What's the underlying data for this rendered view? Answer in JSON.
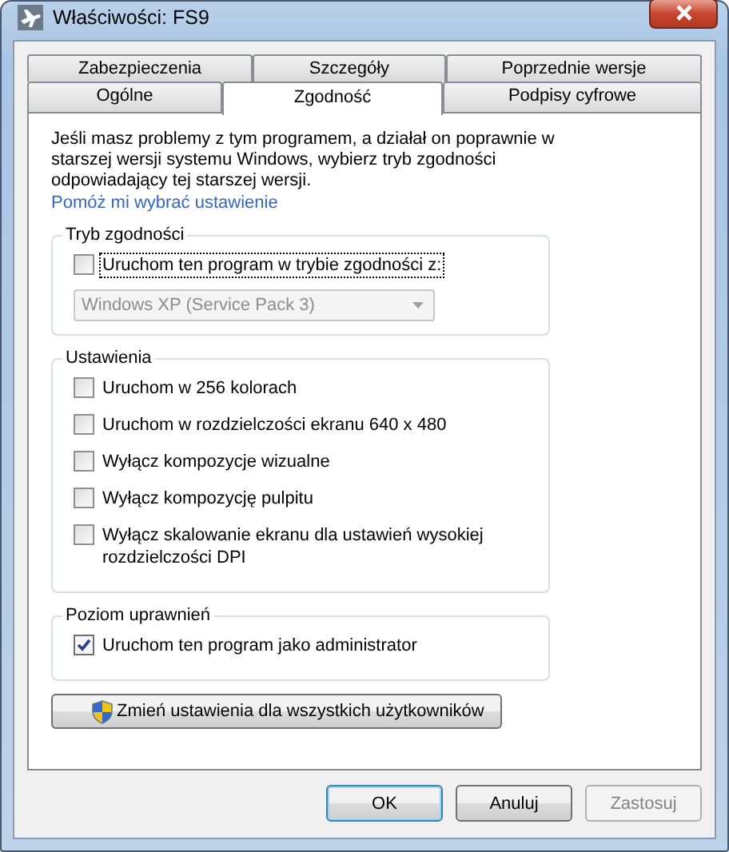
{
  "window": {
    "title": "Właściwości: FS9"
  },
  "tab_rows": [
    [
      {
        "label": "Zabezpieczenia",
        "selected": false
      },
      {
        "label": "Szczegóły",
        "selected": false
      },
      {
        "label": "Poprzednie wersje",
        "selected": false
      }
    ],
    [
      {
        "label": "Ogólne",
        "selected": false
      },
      {
        "label": "Zgodność",
        "selected": true
      },
      {
        "label": "Podpisy cyfrowe",
        "selected": false
      }
    ]
  ],
  "intro": "Jeśli masz problemy z tym programem, a działał on poprawnie w starszej wersji systemu Windows, wybierz tryb zgodności odpowiadający tej starszej wersji.",
  "help_link": "Pomóż mi wybrać ustawienie",
  "groups": [
    {
      "title": "Tryb zgodności",
      "items": [
        {
          "kind": "checkbox",
          "label": "Uruchom ten program w trybie zgodności z:",
          "checked": false,
          "focused": true
        },
        {
          "kind": "dropdown",
          "value": "Windows XP (Service Pack 3)",
          "disabled": true
        }
      ]
    },
    {
      "title": "Ustawienia",
      "items": [
        {
          "kind": "checkbox",
          "label": "Uruchom w 256 kolorach",
          "checked": false,
          "focused": false
        },
        {
          "kind": "checkbox",
          "label": "Uruchom w rozdzielczości ekranu 640 x 480",
          "checked": false,
          "focused": false
        },
        {
          "kind": "checkbox",
          "label": "Wyłącz kompozycje wizualne",
          "checked": false,
          "focused": false
        },
        {
          "kind": "checkbox",
          "label": "Wyłącz kompozycję pulpitu",
          "checked": false,
          "focused": false
        },
        {
          "kind": "checkbox",
          "label": "Wyłącz skalowanie ekranu dla ustawień wysokiej rozdzielczości DPI",
          "checked": false,
          "focused": false
        }
      ]
    },
    {
      "title": "Poziom uprawnień",
      "items": [
        {
          "kind": "checkbox",
          "label": "Uruchom ten program jako administrator",
          "checked": true,
          "focused": false
        }
      ]
    }
  ],
  "all_users_button": "Zmień ustawienia dla wszystkich użytkowników",
  "buttons": [
    {
      "label": "OK",
      "default": true,
      "disabled": false
    },
    {
      "label": "Anuluj",
      "default": false,
      "disabled": false
    },
    {
      "label": "Zastosuj",
      "default": false,
      "disabled": true
    }
  ]
}
